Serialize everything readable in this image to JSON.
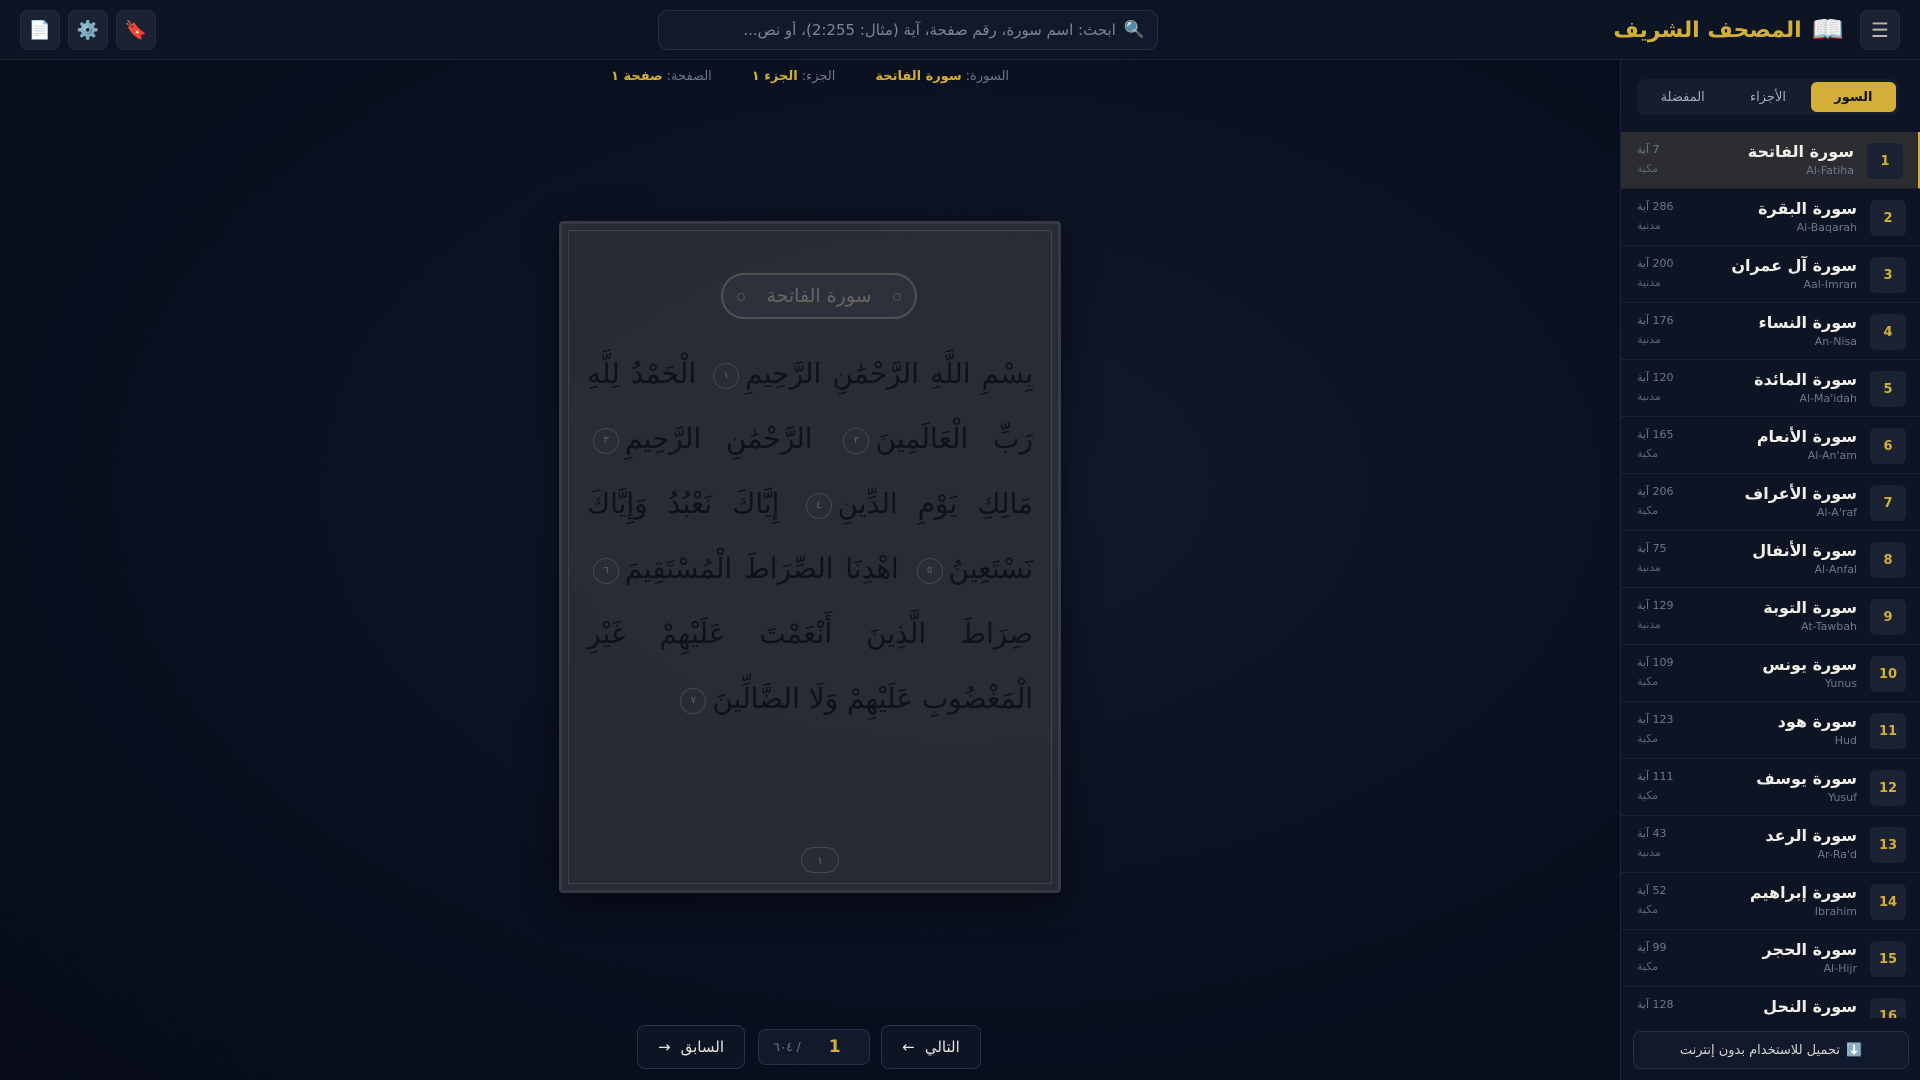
{
  "app": {
    "title": "المصحف الشريف",
    "logo_icon": "📖",
    "menu_icon": "☰"
  },
  "search": {
    "placeholder": "ابحث: اسم سورة، رقم صفحة، آية (مثال: 2:255)، أو نص...",
    "icon": "🔍",
    "value": ""
  },
  "toolbar": {
    "bookmark_icon": "🔖",
    "settings_icon": "⚙️",
    "page_icon": "📄"
  },
  "info": {
    "surah_label": "السورة:",
    "surah_value": "سورة الفاتحة",
    "juz_label": "الجزء:",
    "juz_value": "الجزء ١",
    "page_label": "الصفحة:",
    "page_value": "صفحة ١"
  },
  "mushaf": {
    "surah_title": "سورة الفاتحة",
    "verses": [
      {
        "text": "بِسْمِ اللَّهِ الرَّحْمَٰنِ الرَّحِيمِ",
        "num": "١"
      },
      {
        "text": "الْحَمْدُ لِلَّهِ رَبِّ الْعَالَمِينَ",
        "num": "٢"
      },
      {
        "text": "الرَّحْمَٰنِ الرَّحِيمِ",
        "num": "٣"
      },
      {
        "text": "مَالِكِ يَوْمِ الدِّينِ",
        "num": "٤"
      },
      {
        "text": "إِيَّاكَ نَعْبُدُ وَإِيَّاكَ نَسْتَعِينُ",
        "num": "٥"
      },
      {
        "text": "اهْدِنَا الصِّرَاطَ الْمُسْتَقِيمَ",
        "num": "٦"
      },
      {
        "text": "صِرَاطَ الَّذِينَ أَنْعَمْتَ عَلَيْهِمْ غَيْرِ الْمَغْضُوبِ عَلَيْهِمْ وَلَا الضَّالِّينَ",
        "num": "٧"
      }
    ],
    "page_number": "١"
  },
  "nav": {
    "prev_label": "السابق",
    "prev_arrow": "→",
    "next_label": "التالي",
    "next_arrow": "←",
    "current_page": "1",
    "total_pages": "/ ٦٠٤"
  },
  "sidebar": {
    "tabs": [
      {
        "label": "السور",
        "active": true
      },
      {
        "label": "الأجزاء",
        "active": false
      },
      {
        "label": "المفضلة",
        "active": false
      }
    ],
    "surahs": [
      {
        "num": "1",
        "ar": "سورة الفاتحة",
        "en": "Al-Fatiha",
        "ayahs": "7 آية",
        "type": "مكية"
      },
      {
        "num": "2",
        "ar": "سورة البقرة",
        "en": "Al-Baqarah",
        "ayahs": "286 آية",
        "type": "مدنية"
      },
      {
        "num": "3",
        "ar": "سورة آل عمران",
        "en": "Aal-Imran",
        "ayahs": "200 آية",
        "type": "مدنية"
      },
      {
        "num": "4",
        "ar": "سورة النساء",
        "en": "An-Nisa",
        "ayahs": "176 آية",
        "type": "مدنية"
      },
      {
        "num": "5",
        "ar": "سورة المائدة",
        "en": "Al-Ma'idah",
        "ayahs": "120 آية",
        "type": "مدنية"
      },
      {
        "num": "6",
        "ar": "سورة الأنعام",
        "en": "Al-An'am",
        "ayahs": "165 آية",
        "type": "مكية"
      },
      {
        "num": "7",
        "ar": "سورة الأعراف",
        "en": "Al-A'raf",
        "ayahs": "206 آية",
        "type": "مكية"
      },
      {
        "num": "8",
        "ar": "سورة الأنفال",
        "en": "Al-Anfal",
        "ayahs": "75 آية",
        "type": "مدنية"
      },
      {
        "num": "9",
        "ar": "سورة التوبة",
        "en": "At-Tawbah",
        "ayahs": "129 آية",
        "type": "مدنية"
      },
      {
        "num": "10",
        "ar": "سورة يونس",
        "en": "Yunus",
        "ayahs": "109 آية",
        "type": "مكية"
      },
      {
        "num": "11",
        "ar": "سورة هود",
        "en": "Hud",
        "ayahs": "123 آية",
        "type": "مكية"
      },
      {
        "num": "12",
        "ar": "سورة يوسف",
        "en": "Yusuf",
        "ayahs": "111 آية",
        "type": "مكية"
      },
      {
        "num": "13",
        "ar": "سورة الرعد",
        "en": "Ar-Ra'd",
        "ayahs": "43 آية",
        "type": "مدنية"
      },
      {
        "num": "14",
        "ar": "سورة إبراهيم",
        "en": "Ibrahim",
        "ayahs": "52 آية",
        "type": "مكية"
      },
      {
        "num": "15",
        "ar": "سورة الحجر",
        "en": "Al-Hijr",
        "ayahs": "99 آية",
        "type": "مكية"
      },
      {
        "num": "16",
        "ar": "سورة النحل",
        "en": "",
        "ayahs": "128 آية",
        "type": ""
      }
    ],
    "download_icon": "⬇️",
    "download_label": "تحميل للاستخدام بدون إنترنت"
  },
  "colors": {
    "accent": "#d4af37",
    "background": "#0a1020",
    "panel": "#0d1424"
  }
}
